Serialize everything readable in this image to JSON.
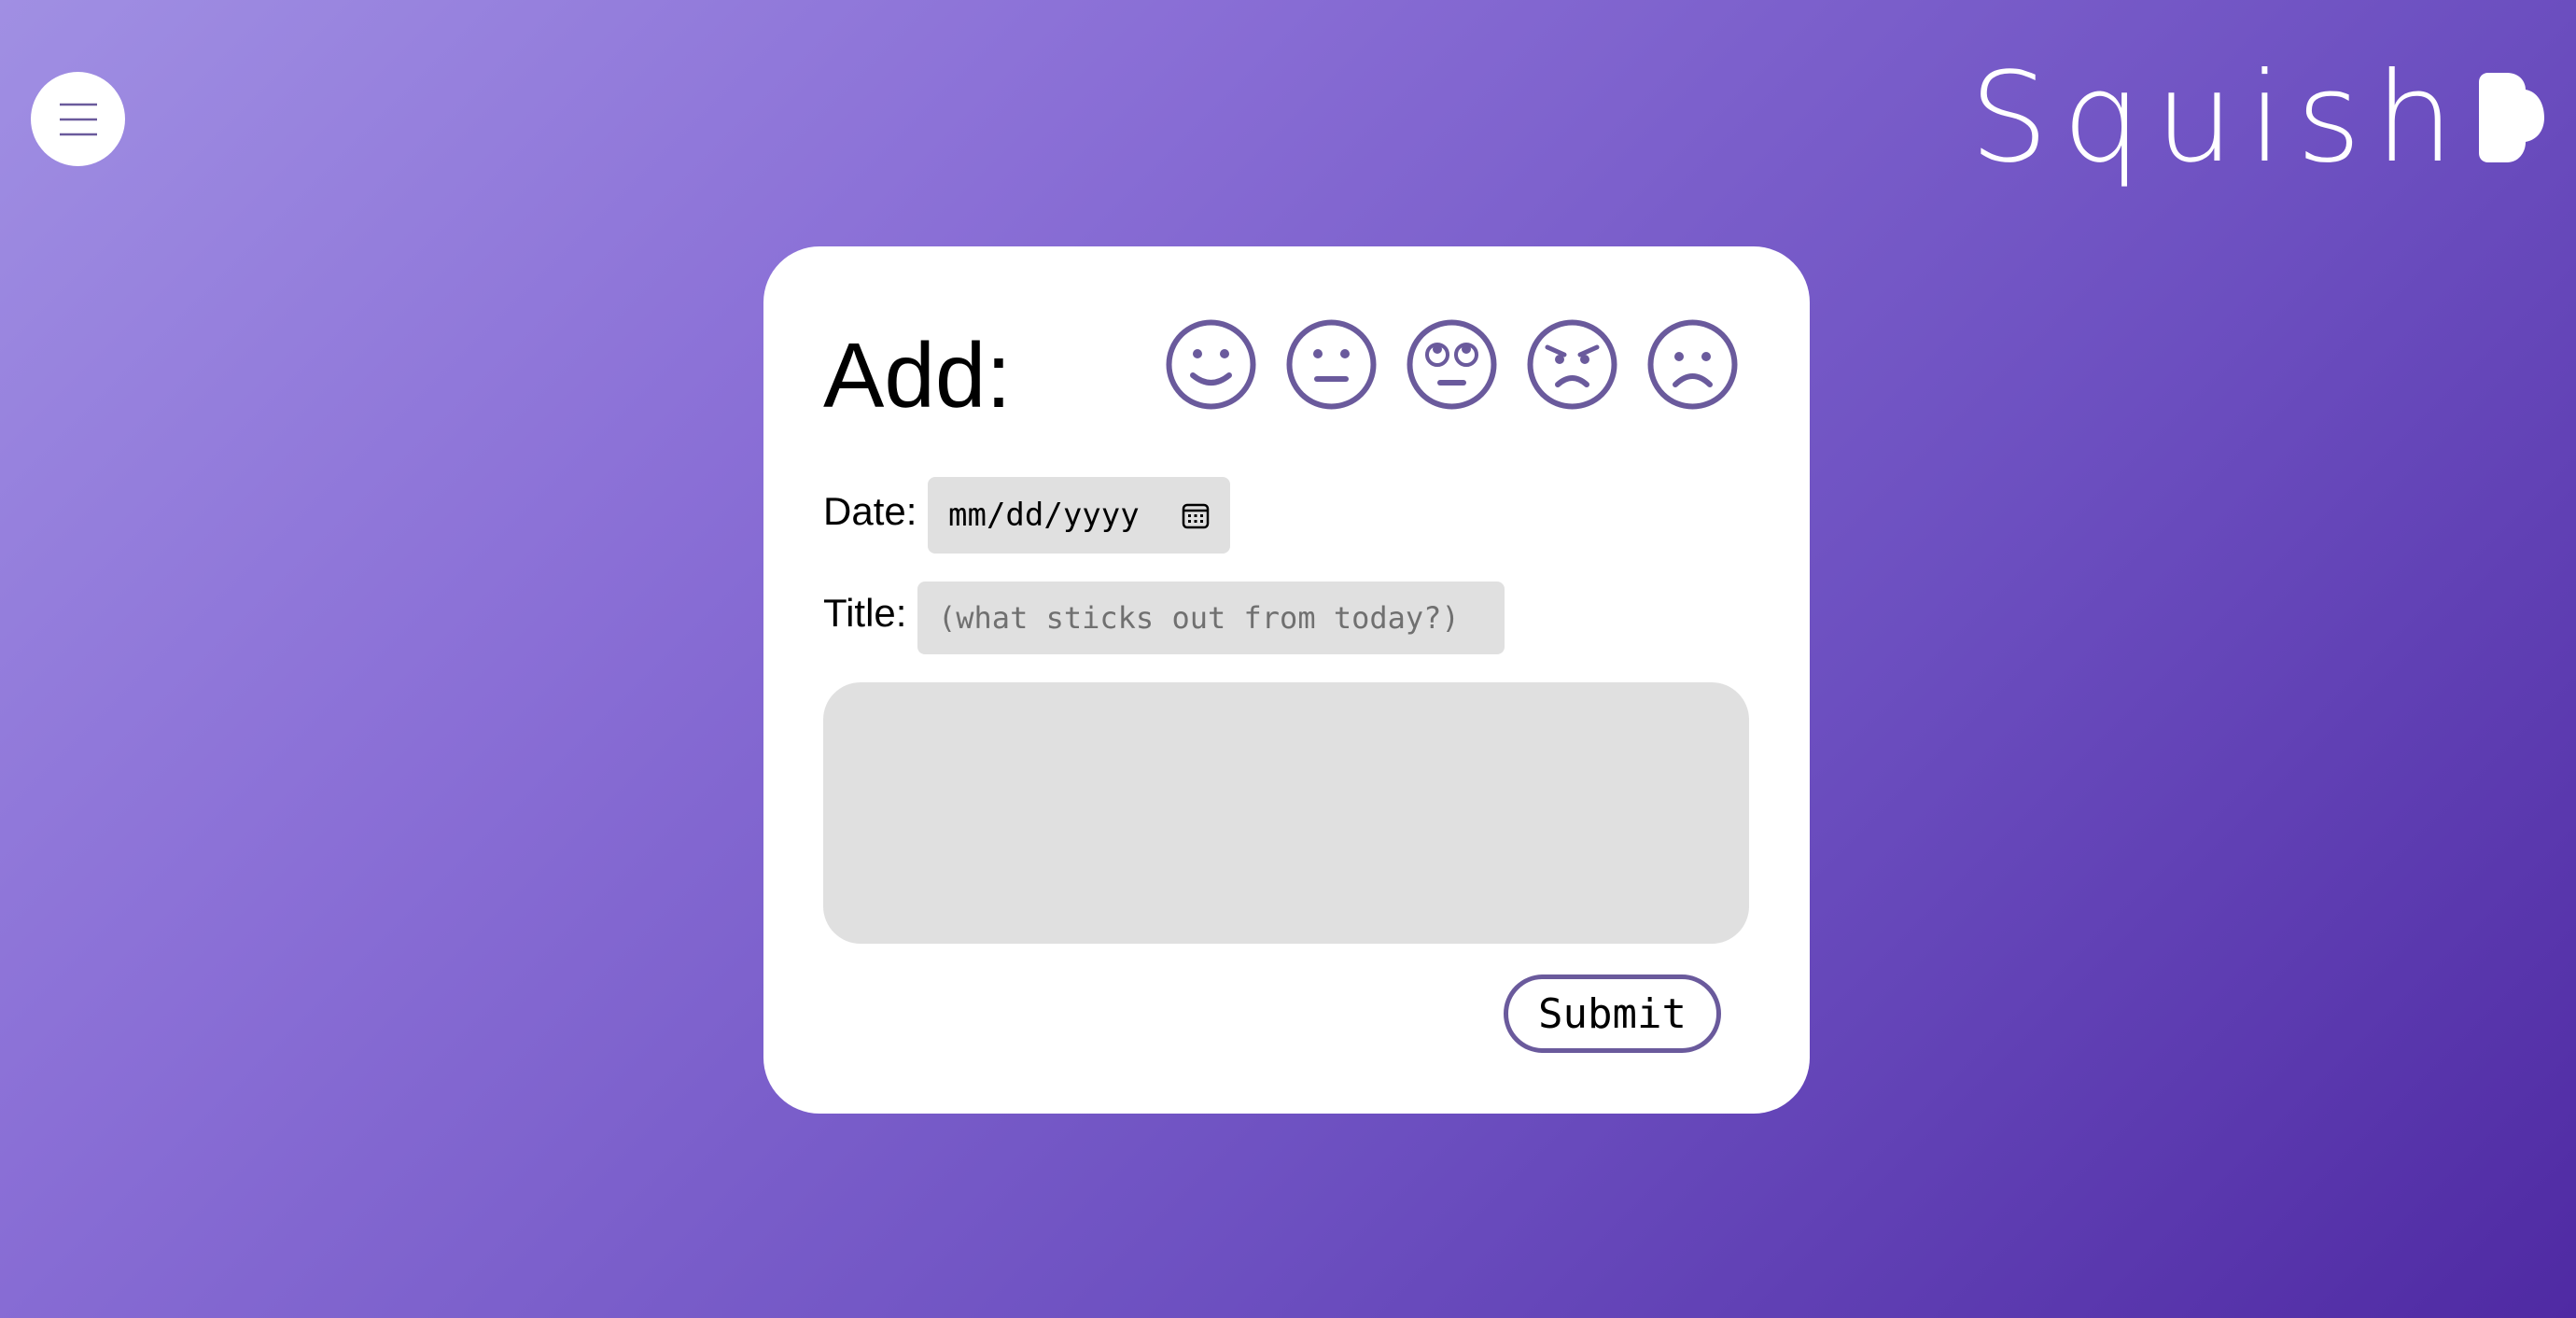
{
  "header": {
    "menu_icon": "hamburger-menu-icon",
    "logo_text": "Squish",
    "logo_mark_icon": "squish-blob-icon"
  },
  "form": {
    "title": "Add:",
    "moods": [
      {
        "name": "happy",
        "icon": "happy-face-icon"
      },
      {
        "name": "neutral",
        "icon": "neutral-face-icon"
      },
      {
        "name": "eye-roll",
        "icon": "eye-roll-face-icon"
      },
      {
        "name": "angry",
        "icon": "angry-face-icon"
      },
      {
        "name": "sad",
        "icon": "sad-face-icon"
      }
    ],
    "date_label": "Date:",
    "date_placeholder": "mm/dd/yyyy",
    "date_icon": "calendar-icon",
    "title_label": "Title:",
    "title_placeholder": "(what sticks out from today?)",
    "body_value": "",
    "submit_label": "Submit"
  },
  "colors": {
    "accent": "#6a5a9c",
    "background_gradient_start": "#a08fe3",
    "background_gradient_end": "#4f2aa3",
    "card": "#ffffff",
    "input_fill": "#e0e0e0"
  }
}
